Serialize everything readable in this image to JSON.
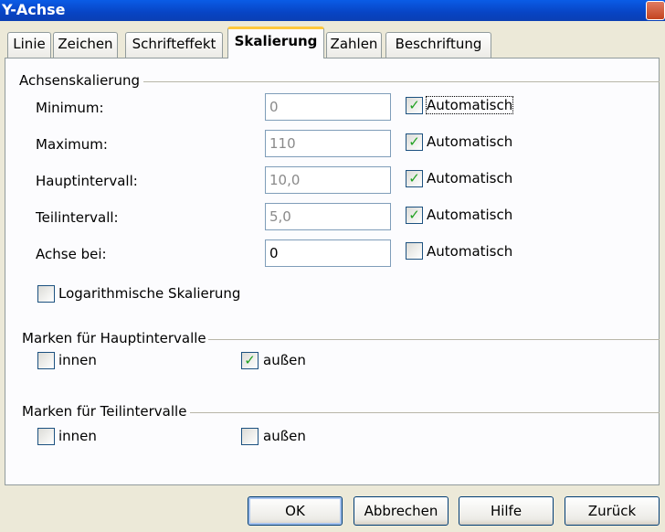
{
  "window": {
    "title": "Y-Achse"
  },
  "tabs": [
    {
      "label": "Linie",
      "active": false
    },
    {
      "label": "Zeichen",
      "active": false
    },
    {
      "label": "Schrifteffekt",
      "active": false
    },
    {
      "label": "Skalierung",
      "active": true
    },
    {
      "label": "Zahlen",
      "active": false
    },
    {
      "label": "Beschriftung",
      "active": false
    }
  ],
  "scaling": {
    "group_label": "Achsenskalierung",
    "rows": [
      {
        "label": "Minimum:",
        "value": "0",
        "auto_label": "Automatisch",
        "auto": true
      },
      {
        "label": "Maximum:",
        "value": "110",
        "auto_label": "Automatisch",
        "auto": true
      },
      {
        "label": "Hauptintervall:",
        "value": "10,0",
        "auto_label": "Automatisch",
        "auto": true
      },
      {
        "label": "Teilintervall:",
        "value": "5,0",
        "auto_label": "Automatisch",
        "auto": true
      },
      {
        "label": "Achse bei:",
        "value": "0",
        "auto_label": "Automatisch",
        "auto": false
      }
    ],
    "log_label": "Logarithmische Skalierung",
    "log_checked": false
  },
  "major_ticks": {
    "group_label": "Marken für Hauptintervalle",
    "inner_label": "innen",
    "inner_checked": false,
    "outer_label": "außen",
    "outer_checked": true
  },
  "minor_ticks": {
    "group_label": "Marken für Teilintervalle",
    "inner_label": "innen",
    "inner_checked": false,
    "outer_label": "außen",
    "outer_checked": false
  },
  "buttons": {
    "ok": "OK",
    "cancel": "Abbrechen",
    "help": "Hilfe",
    "back": "Zurück"
  },
  "check_glyph": "✓"
}
